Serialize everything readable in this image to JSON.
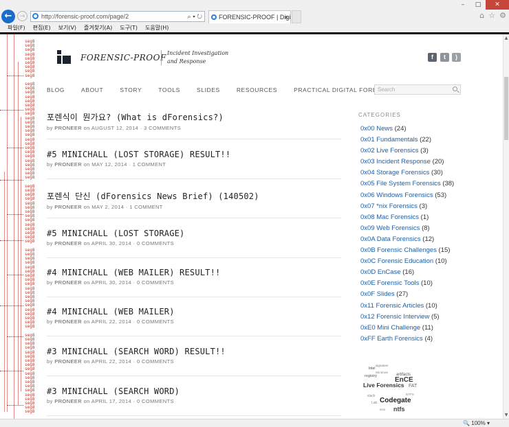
{
  "browser": {
    "url": "http://forensic-proof.com/page/2",
    "tab_title": "FORENSIC-PROOF | Digital...",
    "tab_close": "×",
    "window_controls": [
      "–",
      "□",
      "✕"
    ],
    "menu": [
      "파일(F)",
      "편집(E)",
      "보기(V)",
      "즐겨찾기(A)",
      "도구(T)",
      "도움말(H)"
    ],
    "right_icons": [
      "home-icon",
      "star-icon",
      "gear-icon"
    ],
    "zoom": "100%"
  },
  "graph_strip": {
    "label": "seg8",
    "row_count": 88
  },
  "site": {
    "brand": "FORENSIC-PROOF",
    "tagline_1": "Incident Investigation",
    "tagline_2": "and Response",
    "social": [
      {
        "name": "facebook-icon",
        "glyph": "f"
      },
      {
        "name": "twitter-icon",
        "glyph": "t"
      },
      {
        "name": "rss-icon",
        "glyph": ")"
      }
    ]
  },
  "nav": [
    "BLOG",
    "ABOUT",
    "STORY",
    "TOOLS",
    "SLIDES",
    "RESOURCES",
    "PRACTICAL DIGITAL FORENSICS"
  ],
  "search": {
    "placeholder": "Search"
  },
  "posts": [
    {
      "title": "포렌식이 뭔가요? (What is dForensics?)",
      "by": "by",
      "author": "PRONEER",
      "on": "on",
      "date": "AUGUST 12, 2014",
      "comments": "3 COMMENTS"
    },
    {
      "title": "#5 MINICHALL (LOST STORAGE) RESULT!!",
      "by": "by",
      "author": "PRONEER",
      "on": "on",
      "date": "MAY 12, 2014",
      "comments": "1 COMMENT"
    },
    {
      "title": "포렌식 단신 (dForensics News Brief) (140502)",
      "by": "by",
      "author": "PRONEER",
      "on": "on",
      "date": "MAY 2, 2014",
      "comments": "1 COMMENT"
    },
    {
      "title": "#5 MINICHALL (LOST STORAGE)",
      "by": "by",
      "author": "PRONEER",
      "on": "on",
      "date": "APRIL 30, 2014",
      "comments": "0 COMMENTS"
    },
    {
      "title": "#4 MINICHALL (WEB MAILER) RESULT!!",
      "by": "by",
      "author": "PRONEER",
      "on": "on",
      "date": "APRIL 30, 2014",
      "comments": "0 COMMENTS"
    },
    {
      "title": "#4 MINICHALL (WEB MAILER)",
      "by": "by",
      "author": "PRONEER",
      "on": "on",
      "date": "APRIL 22, 2014",
      "comments": "0 COMMENTS"
    },
    {
      "title": "#3 MINICHALL (SEARCH WORD) RESULT!!",
      "by": "by",
      "author": "PRONEER",
      "on": "on",
      "date": "APRIL 22, 2014",
      "comments": "0 COMMENTS"
    },
    {
      "title": "#3 MINICHALL (SEARCH WORD)",
      "by": "by",
      "author": "PRONEER",
      "on": "on",
      "date": "APRIL 17, 2014",
      "comments": "0 COMMENTS"
    }
  ],
  "sidebar": {
    "heading": "CATEGORIES",
    "categories": [
      {
        "label": "0x00 News",
        "count": "(24)"
      },
      {
        "label": "0x01 Fundamentals",
        "count": "(22)"
      },
      {
        "label": "0x02 Live Forensics",
        "count": "(3)"
      },
      {
        "label": "0x03 Incident Response",
        "count": "(20)"
      },
      {
        "label": "0x04 Storage Forensics",
        "count": "(30)"
      },
      {
        "label": "0x05 File System Forensics",
        "count": "(38)"
      },
      {
        "label": "0x06 Windows Forensics",
        "count": "(53)"
      },
      {
        "label": "0x07 *nix Forensics",
        "count": "(3)"
      },
      {
        "label": "0x08 Mac Forensics",
        "count": "(1)"
      },
      {
        "label": "0x09 Web Forensics",
        "count": "(8)"
      },
      {
        "label": "0x0A Data Forensics",
        "count": "(12)"
      },
      {
        "label": "0x0B Forensic Challenges",
        "count": "(15)"
      },
      {
        "label": "0x0C Forensic Education",
        "count": "(10)"
      },
      {
        "label": "0x0D EnCase",
        "count": "(16)"
      },
      {
        "label": "0x0E Forensic Tools",
        "count": "(10)"
      },
      {
        "label": "0x0F Slides",
        "count": "(27)"
      },
      {
        "label": "0x11 Forensic Articles",
        "count": "(10)"
      },
      {
        "label": "0x12 Forensic Interview",
        "count": "(5)"
      },
      {
        "label": "0xE0 Mini Challenge",
        "count": "(11)"
      },
      {
        "label": "0xFF Earth Forensics",
        "count": "(4)"
      }
    ],
    "tag_cloud": [
      "signature",
      "Intel",
      "artifacts",
      "registry",
      "Windows",
      "EnCE",
      "Live Forensics",
      "FAT",
      "Codegate",
      "ntfs",
      "scsi",
      "NTFS",
      "slack",
      "Lab"
    ]
  },
  "colors": {
    "link": "#1f5fa8",
    "graph": "#c0392b",
    "ie_blue": "#1b6dcc"
  }
}
